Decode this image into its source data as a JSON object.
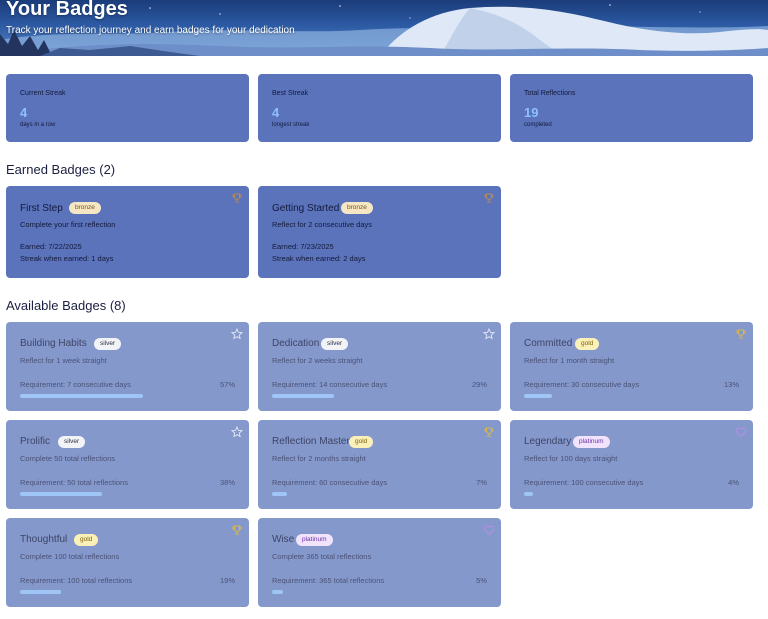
{
  "header": {
    "title": "Your Badges",
    "subtitle": "Track your reflection journey and earn badges for your dedication"
  },
  "stats": [
    {
      "label": "Current Streak",
      "value": "4",
      "sub": "days in a row"
    },
    {
      "label": "Best Streak",
      "value": "4",
      "sub": "longest streak"
    },
    {
      "label": "Total Reflections",
      "value": "19",
      "sub": "completed"
    }
  ],
  "earned": {
    "title": "Earned Badges (2)",
    "badges": [
      {
        "name": "First Step",
        "tier": "bronze",
        "description": "Complete your first reflection",
        "earned": "Earned: 7/22/2025",
        "streak": "Streak when earned: 1 days",
        "icon": "trophy-icon"
      },
      {
        "name": "Getting Started",
        "tier": "bronze",
        "description": "Reflect for 2 consecutive days",
        "earned": "Earned: 7/23/2025",
        "streak": "Streak when earned: 2 days",
        "icon": "trophy-icon"
      }
    ]
  },
  "available": {
    "title": "Available Badges (8)",
    "badges": [
      {
        "name": "Building Habits",
        "tier": "silver",
        "description": "Reflect for 1 week straight",
        "requirement": "Requirement: 7 consecutive days",
        "percent_label": "57%",
        "progress": 0.57,
        "icon": "star-icon"
      },
      {
        "name": "Dedication",
        "tier": "silver",
        "description": "Reflect for 2 weeks straight",
        "requirement": "Requirement: 14 consecutive days",
        "percent_label": "29%",
        "progress": 0.29,
        "icon": "star-icon"
      },
      {
        "name": "Committed",
        "tier": "gold",
        "description": "Reflect for 1 month straight",
        "requirement": "Requirement: 30 consecutive days",
        "percent_label": "13%",
        "progress": 0.13,
        "icon": "trophy-icon"
      },
      {
        "name": "Prolific",
        "tier": "silver",
        "description": "Complete 50 total reflections",
        "requirement": "Requirement: 50 total reflections",
        "percent_label": "38%",
        "progress": 0.38,
        "icon": "star-icon"
      },
      {
        "name": "Reflection Master",
        "tier": "gold",
        "description": "Reflect for 2 months straight",
        "requirement": "Requirement: 60 consecutive days",
        "percent_label": "7%",
        "progress": 0.07,
        "icon": "trophy-icon"
      },
      {
        "name": "Legendary",
        "tier": "platinum",
        "description": "Reflect for 100 days straight",
        "requirement": "Requirement: 100 consecutive days",
        "percent_label": "4%",
        "progress": 0.04,
        "icon": "heart-icon"
      },
      {
        "name": "Thoughtful",
        "tier": "gold",
        "description": "Complete 100 total reflections",
        "requirement": "Requirement: 100 total reflections",
        "percent_label": "19%",
        "progress": 0.19,
        "icon": "trophy-icon"
      },
      {
        "name": "Wise",
        "tier": "platinum",
        "description": "Complete 365 total reflections",
        "requirement": "Requirement: 365 total reflections",
        "percent_label": "5%",
        "progress": 0.05,
        "icon": "heart-icon"
      }
    ]
  },
  "colors": {
    "bronze_icon": "#b78a5a",
    "silver_icon": "#e3e8f5",
    "gold_icon": "#d9b84a",
    "platinum_icon": "#b48de6",
    "progress_fill": "#9ec5f5"
  }
}
